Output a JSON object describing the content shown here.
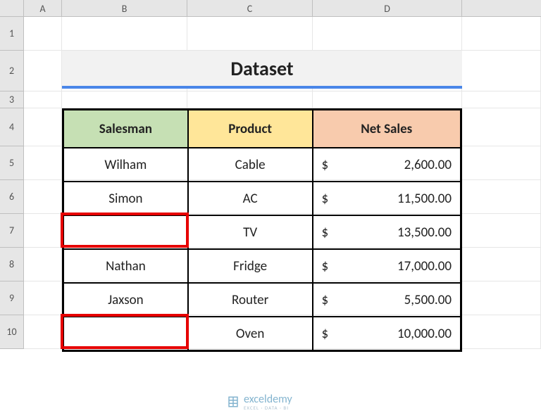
{
  "columns": {
    "corner": "",
    "A": "A",
    "B": "B",
    "C": "C",
    "D": "D"
  },
  "rows": {
    "1": "1",
    "2": "2",
    "3": "3",
    "4": "4",
    "5": "5",
    "6": "6",
    "7": "7",
    "8": "8",
    "9": "9",
    "10": "10"
  },
  "title": "Dataset",
  "headers": {
    "salesman": "Salesman",
    "product": "Product",
    "netsales": "Net Sales"
  },
  "data": [
    {
      "salesman": "Wilham",
      "product": "Cable",
      "currency": "$",
      "sales": "2,600.00"
    },
    {
      "salesman": "Simon",
      "product": "AC",
      "currency": "$",
      "sales": "11,500.00"
    },
    {
      "salesman": "",
      "product": "TV",
      "currency": "$",
      "sales": "13,500.00"
    },
    {
      "salesman": "Nathan",
      "product": "Fridge",
      "currency": "$",
      "sales": "17,000.00"
    },
    {
      "salesman": "Jaxson",
      "product": "Router",
      "currency": "$",
      "sales": "5,500.00"
    },
    {
      "salesman": "",
      "product": "Oven",
      "currency": "$",
      "sales": "10,000.00"
    }
  ],
  "watermark": {
    "brand": "exceldemy",
    "tagline": "EXCEL · DATA · BI"
  },
  "layout": {
    "colA_w": 54,
    "colB_w": 178,
    "colC_w": 178,
    "colD_w": 212,
    "extra_w": 112,
    "row1_h": 48,
    "row2_h": 58,
    "row3_h": 24,
    "rowHdr_h": 54,
    "rowData_h": 48
  }
}
